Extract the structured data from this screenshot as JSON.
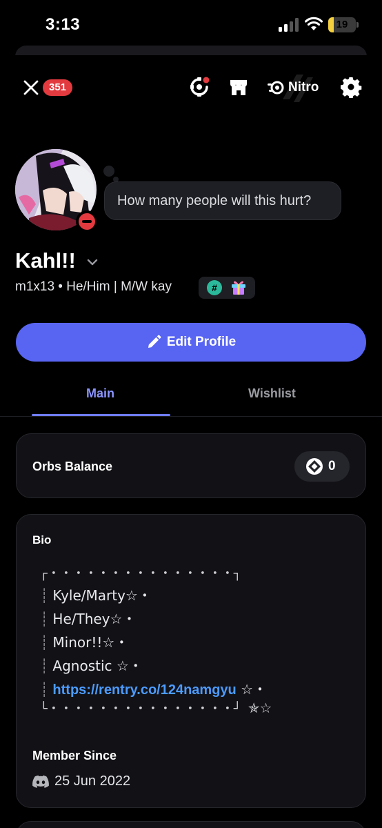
{
  "status_bar": {
    "time": "3:13",
    "battery_level": "19",
    "battery_fraction": 0.19,
    "signal_icon": "cellular-signal-icon",
    "wifi_icon": "wifi-icon"
  },
  "top_nav": {
    "notification_count": "351",
    "nitro_label": "Nitro"
  },
  "profile": {
    "status_text": "How many people will this hurt?",
    "display_name": "Kahl!!",
    "tagline": "m1x13 • He/Him | M/W kay",
    "status": "do-not-disturb",
    "edit_button": "Edit Profile"
  },
  "tabs": [
    {
      "label": "Main",
      "active": true
    },
    {
      "label": "Wishlist",
      "active": false
    }
  ],
  "orbs": {
    "label": "Orbs Balance",
    "value": "0"
  },
  "bio": {
    "title": "Bio",
    "border_top": "┌・・・・・・・・・・・・・・・┐",
    "lines": [
      "Kyle/Marty☆・",
      "He/They☆・",
      "Minor!!☆・",
      "Agnostic ☆・"
    ],
    "link": "https://rentry.co/124namgyu",
    "link_suffix": " ☆・",
    "border_bottom": "└・・・・・・・・・・・・・・・┘",
    "border_bottom_suffix": "✯☆"
  },
  "member_since": {
    "title": "Member Since",
    "date": "25 Jun 2022"
  },
  "colors": {
    "accent": "#5865f2",
    "tab_active": "#8b95ff",
    "badge_red": "#e23a3f",
    "link_blue": "#4c9bff",
    "battery_yellow": "#f4d03f"
  }
}
